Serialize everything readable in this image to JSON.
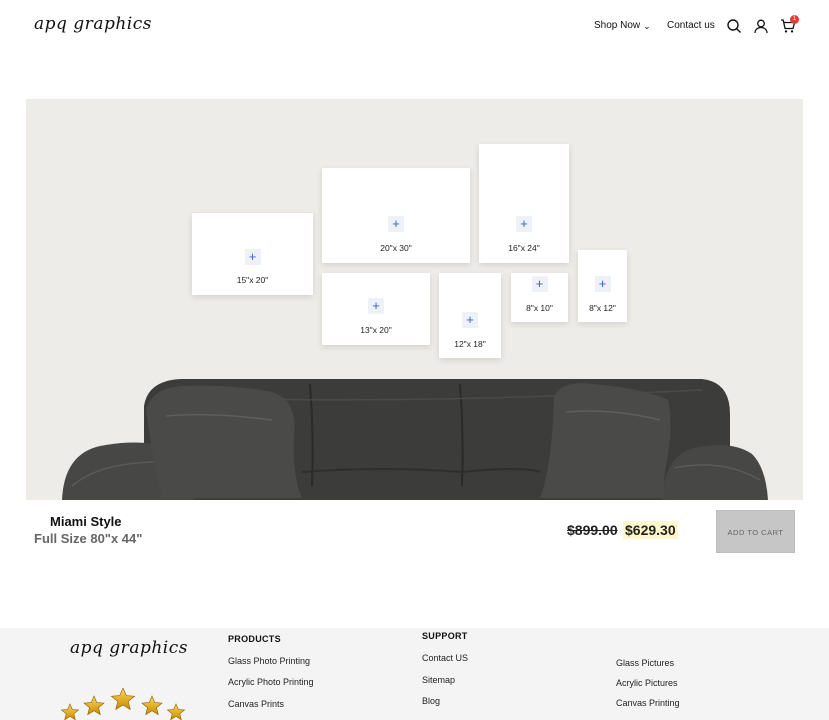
{
  "header": {
    "logo": "apq graphics",
    "nav": [
      {
        "label": "Shop Now"
      },
      {
        "label": "Contact us"
      }
    ],
    "cart_count": "1",
    "icons": [
      "search-icon",
      "user-icon",
      "cart-icon",
      "chevron-down-icon"
    ]
  },
  "hero": {
    "frames": [
      {
        "size": "15\"x 20\""
      },
      {
        "size": "20\"x 30\""
      },
      {
        "size": "16\"x 24\""
      },
      {
        "size": "13\"x 20\""
      },
      {
        "size": "12\"x 18\""
      },
      {
        "size": "8\"x 10\""
      },
      {
        "size": "8\"x 12\""
      }
    ],
    "plus_label": "+"
  },
  "product": {
    "name": "Miami Style",
    "full_size": "Full Size 80\"x 44\"",
    "old_price": "$899.00",
    "new_price": "$629.30",
    "add_to_cart": "ADD TO CART"
  },
  "footer": {
    "logo": "apq graphics",
    "products_heading": "PRODUCTS",
    "products": [
      "Glass Photo Printing",
      "Acrylic Photo Printing",
      "Canvas Prints"
    ],
    "support_heading": "SUPPORT",
    "support": [
      "Contact US",
      "Sitemap",
      "Blog"
    ],
    "other": [
      "Glass Pictures",
      "Acrylic Pictures",
      "Canvas Printing"
    ]
  },
  "colors": {
    "hero_bg": "#eeece8",
    "price_highlight": "#fff7cc",
    "badge": "#e53935",
    "plus_icon": "#3366cc",
    "button_bg": "#c6c6c6"
  }
}
